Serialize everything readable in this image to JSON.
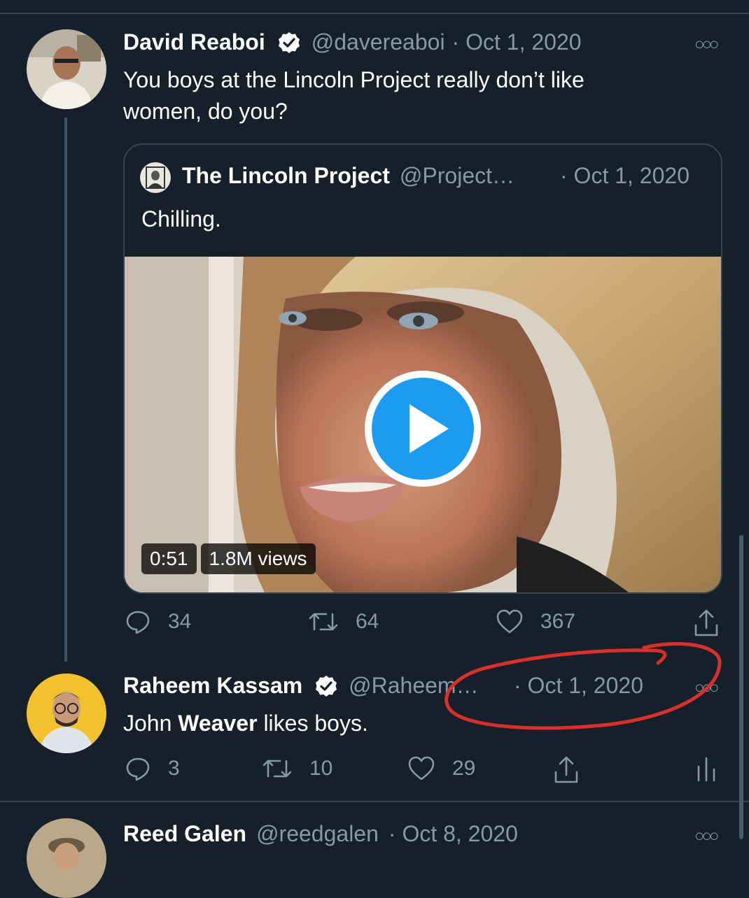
{
  "tweets": {
    "main": {
      "name": "David Reaboi",
      "handle": "@davereaboi",
      "date": "· Oct 1, 2020",
      "text_line1": "You boys at the Lincoln Project really don’t like",
      "text_line2": "women, do you?",
      "replies": "34",
      "retweets": "64",
      "likes": "367"
    },
    "quoted": {
      "name": "The Lincoln Project",
      "handle": "@Project…",
      "date": "· Oct 1, 2020",
      "text": "Chilling.",
      "video_duration": "0:51",
      "video_views": "1.8M views"
    },
    "reply": {
      "name": "Raheem Kassam",
      "handle": "@Raheem…",
      "date": "· Oct 1, 2020",
      "text_pre": "John ",
      "text_bold": "Weaver",
      "text_post": " likes boys.",
      "replies": "3",
      "retweets": "10",
      "likes": "29"
    },
    "next": {
      "name": "Reed Galen",
      "handle": "@reedgalen",
      "date": "· Oct 8, 2020"
    }
  },
  "colors": {
    "background": "#15202b",
    "muted": "#8899a6",
    "verified": "#ffffff",
    "annotation": "#d9302b",
    "play": "#1d9bf0"
  },
  "icons": [
    "verified-badge-icon",
    "more-icon",
    "reply-icon",
    "retweet-icon",
    "like-icon",
    "share-icon",
    "analytics-icon",
    "play-icon"
  ]
}
